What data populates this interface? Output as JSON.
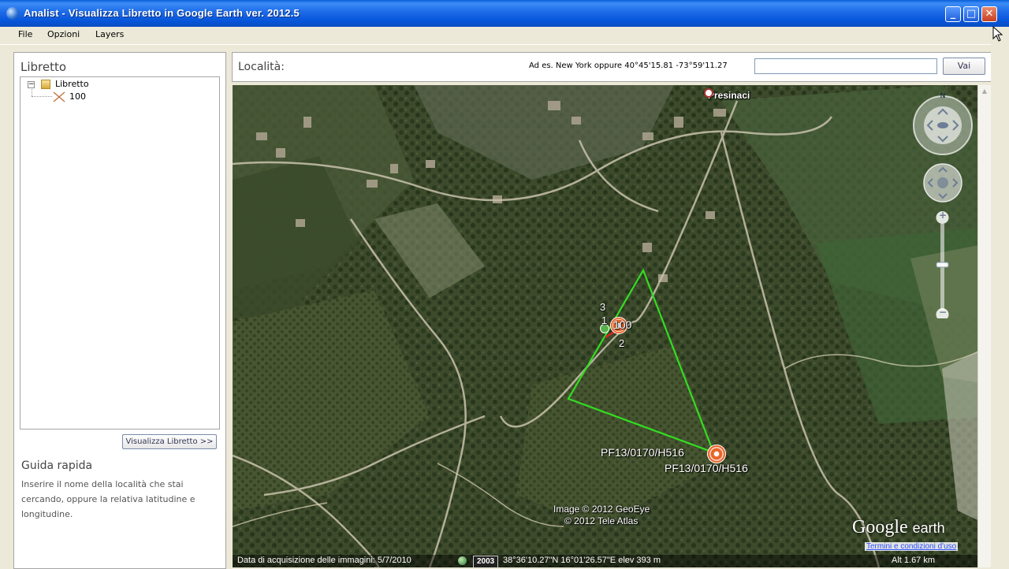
{
  "window": {
    "title": "Analist - Visualizza Libretto in Google Earth ver. 2012.5",
    "min_glyph": "_",
    "max_glyph": "□",
    "close_glyph": "✕"
  },
  "menu": {
    "file": "File",
    "opzioni": "Opzioni",
    "layers": "Layers"
  },
  "left_panel": {
    "heading": "Libretto",
    "tree": {
      "root_toggle": "−",
      "root_label": "Libretto",
      "child_label": "100"
    },
    "view_button": "Visualizza Libretto >>",
    "guide_heading": "Guida rapida",
    "guide_text": "Inserire il nome della località che stai cercando, oppure la relativa latitudine e longitudine."
  },
  "location_bar": {
    "label": "Località:",
    "hint": "Ad es. New York oppure 40°45'15.81 -73°59'11.27",
    "search_value": "",
    "go_button": "Vai"
  },
  "map": {
    "town_label": "Presinaci",
    "point_labels": {
      "p1": "1",
      "p2": "2",
      "p3": "3",
      "center": "100"
    },
    "marker_label_a": "PF13/0170/H516",
    "marker_label_b": "PF13/0170/H516",
    "credit_line1": "Image © 2012 GeoEye",
    "credit_line2": "© 2012 Tele Atlas",
    "logo_google": "Google",
    "logo_earth": "earth",
    "terms_link": "Termini e condizioni d'uso",
    "compass_north": "N",
    "zoom_in": "+",
    "zoom_out": "−",
    "status": {
      "acquisition": "Data di acquisizione delle immagini: 5/7/2010",
      "year": "2003",
      "coords": "38°36'10.27\"N  16°01'26.57\"E  elev  393 m",
      "alt": "Alt   1.67 km"
    },
    "colors": {
      "polygon": "#33dd22",
      "marker": "#e8652a"
    }
  }
}
